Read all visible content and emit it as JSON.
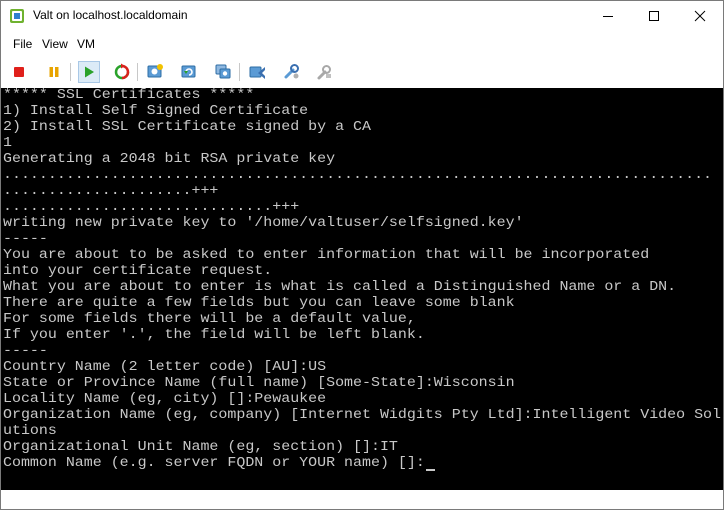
{
  "window": {
    "title": "Valt on localhost.localdomain"
  },
  "menu": {
    "items": [
      "File",
      "View",
      "VM"
    ]
  },
  "toolbar": {
    "buttons": [
      {
        "icon": "stop-icon"
      },
      {
        "icon": "pause-icon"
      },
      {
        "icon": "play-icon"
      },
      {
        "icon": "reset-icon"
      },
      {
        "icon": "snapshot-take-icon"
      },
      {
        "icon": "snapshot-revert-icon"
      },
      {
        "icon": "snapshot-manager-icon"
      },
      {
        "icon": "send-keys-icon"
      },
      {
        "icon": "settings-wrench-icon"
      },
      {
        "icon": "tools-disabled-icon"
      }
    ]
  },
  "colors": {
    "console_bg": "#000000",
    "console_fg": "#c8c8c8"
  },
  "console": {
    "lines": [
      "***** SSL Certificates *****",
      "1) Install Self Signed Certificate",
      "2) Install SSL Certificate signed by a CA",
      "1",
      "Generating a 2048 bit RSA private key",
      "...............................................................................",
      ".....................+++",
      "..............................+++",
      "writing new private key to '/home/valtuser/selfsigned.key'",
      "-----",
      "You are about to be asked to enter information that will be incorporated",
      "into your certificate request.",
      "What you are about to enter is what is called a Distinguished Name or a DN.",
      "There are quite a few fields but you can leave some blank",
      "For some fields there will be a default value,",
      "If you enter '.', the field will be left blank.",
      "-----",
      "Country Name (2 letter code) [AU]:US",
      "State or Province Name (full name) [Some-State]:Wisconsin",
      "Locality Name (eg, city) []:Pewaukee",
      "Organization Name (eg, company) [Internet Widgits Pty Ltd]:Intelligent Video Sol",
      "utions",
      "Organizational Unit Name (eg, section) []:IT",
      "Common Name (e.g. server FQDN or YOUR name) []:"
    ]
  }
}
